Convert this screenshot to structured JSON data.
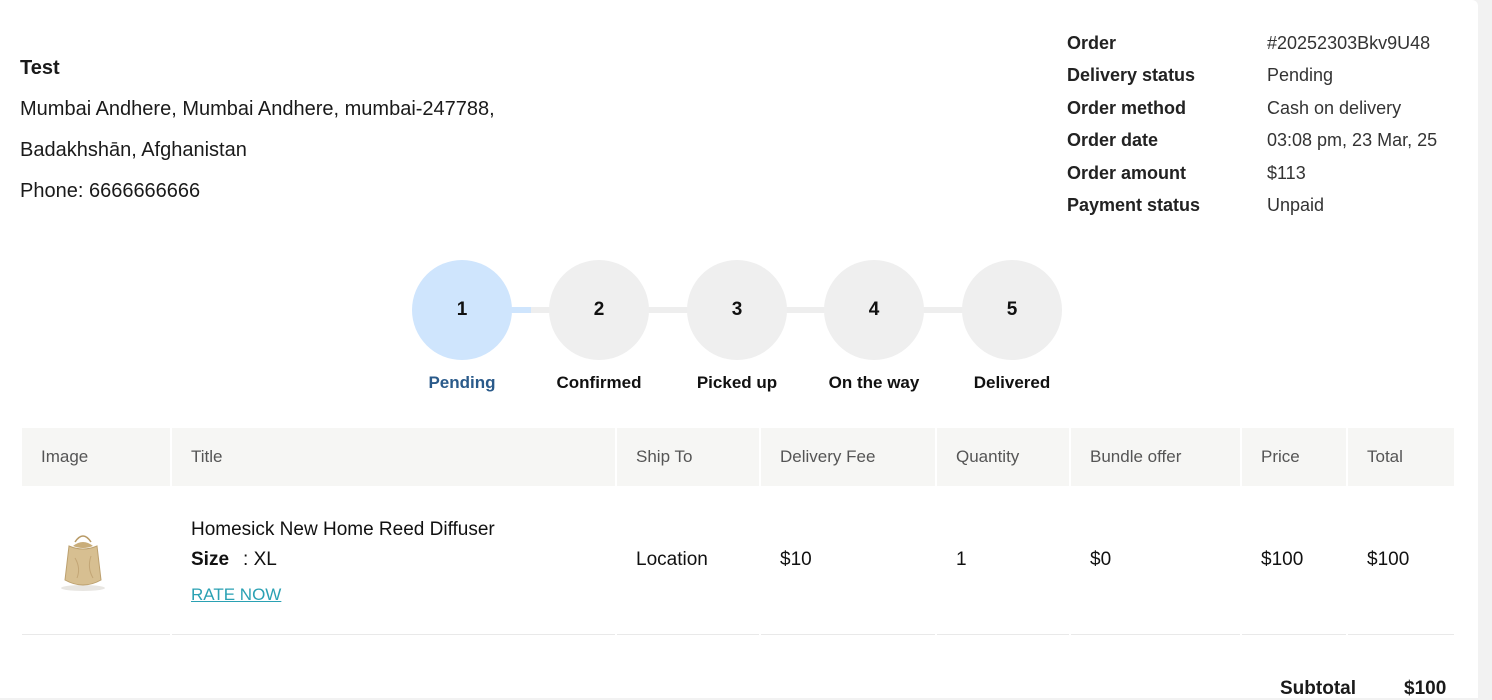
{
  "customer": {
    "name": "Test",
    "address_line1": "Mumbai Andhere, Mumbai Andhere, mumbai-247788,",
    "address_line2": "Badakhshān, Afghanistan",
    "phone": "Phone: 6666666666"
  },
  "order_info": [
    {
      "label": "Order",
      "value": "#20252303Bkv9U48"
    },
    {
      "label": "Delivery status",
      "value": "Pending"
    },
    {
      "label": "Order method",
      "value": "Cash on delivery"
    },
    {
      "label": "Order date",
      "value": "03:08 pm, 23 Mar, 25"
    },
    {
      "label": "Order amount",
      "value": "$113"
    },
    {
      "label": "Payment status",
      "value": "Unpaid"
    }
  ],
  "steps": [
    {
      "num": "1",
      "label": "Pending"
    },
    {
      "num": "2",
      "label": "Confirmed"
    },
    {
      "num": "3",
      "label": "Picked up"
    },
    {
      "num": "4",
      "label": "On the way"
    },
    {
      "num": "5",
      "label": "Delivered"
    }
  ],
  "table": {
    "headers": [
      "Image",
      "Title",
      "Ship To",
      "Delivery Fee",
      "Quantity",
      "Bundle offer",
      "Price",
      "Total"
    ],
    "rows": [
      {
        "image_icon": "sachet-product-image",
        "title": "Homesick New Home Reed Diffuser",
        "size_label": "Size",
        "size_value": ": XL",
        "rate_link": "RATE NOW",
        "ship_to": "Location",
        "delivery_fee": "$10",
        "quantity": "1",
        "bundle_offer": "$0",
        "price": "$100",
        "total": "$100"
      }
    ]
  },
  "summary": {
    "subtotal_label": "Subtotal",
    "subtotal_value": "$100"
  },
  "colors": {
    "active_step": "#cfe5fd",
    "active_label": "#2a5a8a",
    "inactive_step": "#efefef",
    "link": "#2aa1b3"
  }
}
